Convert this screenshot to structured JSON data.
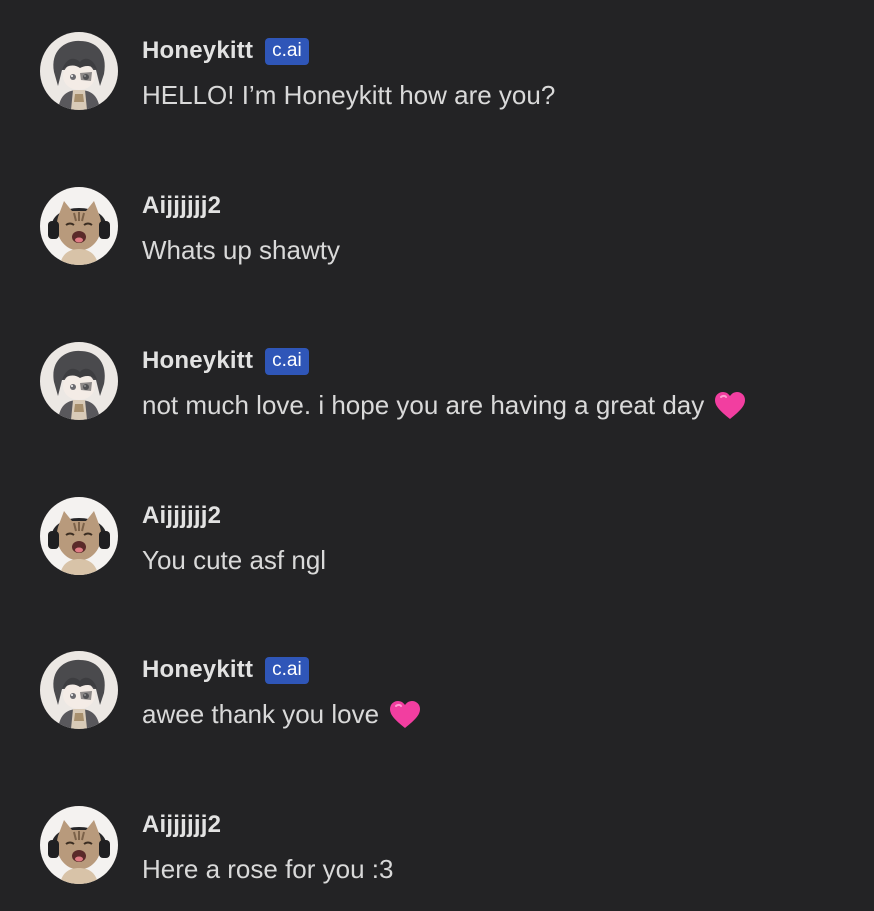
{
  "messages": [
    {
      "author": "Honeykitt",
      "badge": "c.ai",
      "text": "HELLO! I’m Honeykitt how are you?",
      "avatar": "honeykitt-avatar",
      "emoji": ""
    },
    {
      "author": "Aijjjjjj2",
      "badge": "",
      "text": "Whats up shawty",
      "avatar": "cat-headphones-avatar",
      "emoji": ""
    },
    {
      "author": "Honeykitt",
      "badge": "c.ai",
      "text": "not much love. i hope you are having a great day",
      "avatar": "honeykitt-avatar",
      "emoji": "pink-heart-icon"
    },
    {
      "author": "Aijjjjjj2",
      "badge": "",
      "text": "You cute asf ngl",
      "avatar": "cat-headphones-avatar",
      "emoji": ""
    },
    {
      "author": "Honeykitt",
      "badge": "c.ai",
      "text": "awee thank you love",
      "avatar": "honeykitt-avatar",
      "emoji": "pink-heart-icon"
    },
    {
      "author": "Aijjjjjj2",
      "badge": "",
      "text": "Here a rose for you :3",
      "avatar": "cat-headphones-avatar",
      "emoji": ""
    }
  ],
  "colors": {
    "background": "#232325",
    "name": "#e2e2e2",
    "text": "#d9d9d9",
    "badge": "#2f56b8",
    "heart": "#f23ea0"
  }
}
